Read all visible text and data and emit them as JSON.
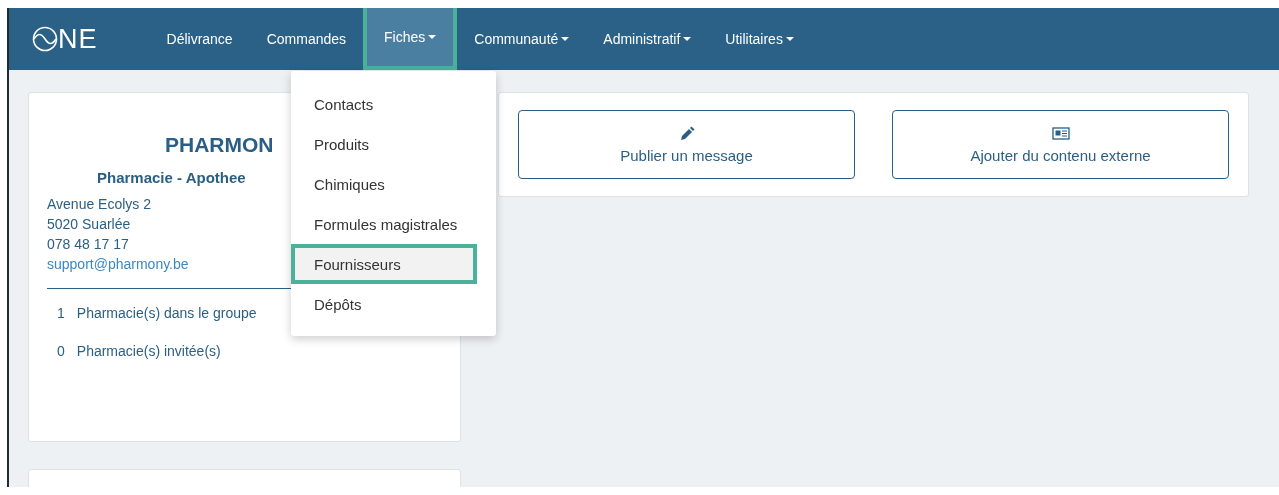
{
  "navbar": {
    "logo": "NE",
    "items": [
      {
        "label": "Délivrance",
        "dropdown": false,
        "selected": false,
        "highlighted": false
      },
      {
        "label": "Commandes",
        "dropdown": false,
        "selected": false,
        "highlighted": false
      },
      {
        "label": "Fiches",
        "dropdown": true,
        "selected": true,
        "highlighted": true
      },
      {
        "label": "Communauté",
        "dropdown": true,
        "selected": false,
        "highlighted": false
      },
      {
        "label": "Administratif",
        "dropdown": true,
        "selected": false,
        "highlighted": false
      },
      {
        "label": "Utilitaires",
        "dropdown": true,
        "selected": false,
        "highlighted": false
      }
    ]
  },
  "dropdown_menu": {
    "items": [
      {
        "label": "Contacts",
        "highlighted": false
      },
      {
        "label": "Produits",
        "highlighted": false
      },
      {
        "label": "Chimiques",
        "highlighted": false
      },
      {
        "label": "Formules magistrales",
        "highlighted": false
      },
      {
        "label": "Fournisseurs",
        "highlighted": true
      },
      {
        "label": "Dépôts",
        "highlighted": false
      }
    ]
  },
  "pharmacy_card": {
    "name": "PHARMON",
    "subtitle": "Pharmacie - Apothee",
    "address": [
      "Avenue Ecolys 2",
      "5020 Suarlée",
      "078 48 17 17"
    ],
    "email": "support@pharmony.be",
    "stats": [
      {
        "count": "1",
        "label": "Pharmacie(s) dans le groupe"
      },
      {
        "count": "0",
        "label": "Pharmacie(s) invitée(s)"
      }
    ]
  },
  "actions": [
    {
      "kind": "pencil",
      "label": "Publier un message"
    },
    {
      "kind": "newspaper",
      "label": "Ajouter du contenu externe"
    }
  ]
}
